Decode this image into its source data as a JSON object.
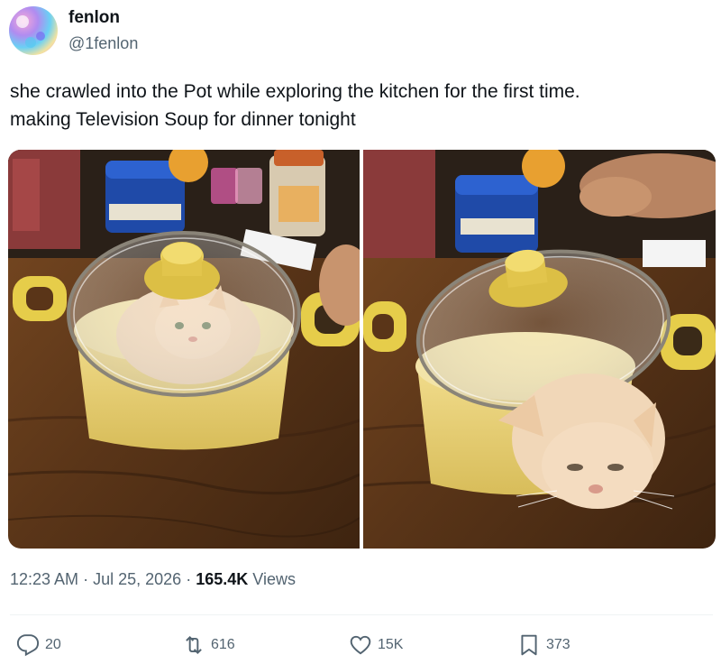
{
  "tweet": {
    "author": {
      "display_name": "fenlon",
      "handle": "@1fenlon"
    },
    "text_lines": [
      "she crawled into the Pot while exploring the kitchen for the first time.",
      "making Television Soup for dinner tonight"
    ],
    "media": [
      {
        "description": "cat inside a yellow pot under a glass lid"
      },
      {
        "description": "cat peeking out from under a glass pot lid"
      }
    ],
    "meta": {
      "time": "12:23 AM",
      "separator": "·",
      "date": "Jul 25, 2026",
      "views_count": "165.4K",
      "views_label": "Views"
    },
    "actions": {
      "replies": {
        "icon": "reply-icon",
        "count": "20"
      },
      "reposts": {
        "icon": "repost-icon",
        "count": "616"
      },
      "likes": {
        "icon": "like-icon",
        "count": "15K"
      },
      "bookmarks": {
        "icon": "bookmark-icon",
        "count": "373"
      }
    }
  },
  "colors": {
    "text_primary": "#0f1419",
    "text_secondary": "#536471",
    "pot_yellow": "#e8d27a",
    "lid_knob": "#e0c043",
    "table_wood": "#5a3a1c"
  }
}
